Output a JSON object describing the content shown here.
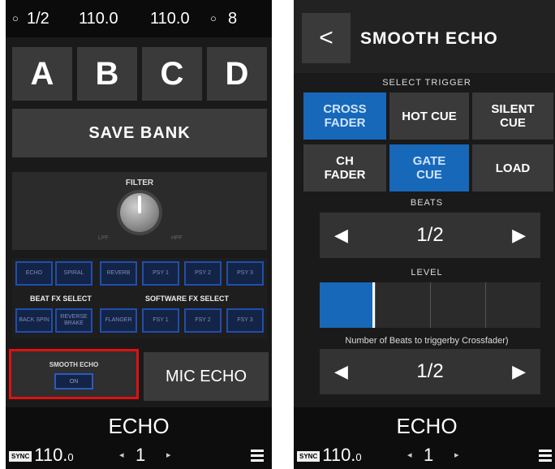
{
  "left": {
    "topbar": {
      "beat": "1/2",
      "bpm1": "110.0",
      "bpm2": "110.0",
      "count": "8",
      "beat_icon": "circle-icon",
      "count_icon": "circle-icon"
    },
    "banks": [
      "A",
      "B",
      "C",
      "D"
    ],
    "save_bank": "SAVE BANK",
    "filter": {
      "label": "FILTER",
      "lpf": "LPF",
      "hpf": "HPF"
    },
    "fx_row1": [
      "ECHO",
      "SPIRAL",
      "REVERB",
      "PSY 1",
      "PSY 2",
      "PSY 3"
    ],
    "fx_row2": [
      "BACK SPIN",
      "REVERSE BRAKE",
      "FLANGER",
      "FSY 1",
      "FSY 2",
      "FSY 3"
    ],
    "beat_fx_label": "BEAT FX SELECT",
    "software_fx_label": "SOFTWARE FX SELECT",
    "smooth_echo": {
      "label": "SMOOTH ECHO",
      "state": "ON"
    },
    "mic_echo": "MIC ECHO",
    "footer": {
      "mode": "ECHO",
      "badge": "SYNC",
      "bpm_main": "110.",
      "bpm_decimal": "0",
      "page": "1",
      "prev": "◂",
      "next": "▸"
    }
  },
  "right": {
    "title": "SMOOTH ECHO",
    "back": "<",
    "select_trigger": "SELECT TRIGGER",
    "triggers": [
      {
        "label": "CROSS\nFADER",
        "active": true
      },
      {
        "label": "HOT CUE",
        "active": false
      },
      {
        "label": "SILENT\nCUE",
        "active": false
      },
      {
        "label": "CH\nFADER",
        "active": false
      },
      {
        "label": "GATE\nCUE",
        "active": true
      },
      {
        "label": "LOAD",
        "active": false
      }
    ],
    "beats_label": "BEATS",
    "beats_value": "1/2",
    "level_label": "LEVEL",
    "level_fraction": 0.25,
    "description": "Number of Beats to triggerby Crossfader)",
    "beats2_value": "1/2",
    "step_left": "◀",
    "step_right": "▶",
    "footer": {
      "mode": "ECHO",
      "badge": "SYNC",
      "bpm_main": "110.",
      "bpm_decimal": "0",
      "page": "1",
      "prev": "◂",
      "next": "▸"
    }
  }
}
